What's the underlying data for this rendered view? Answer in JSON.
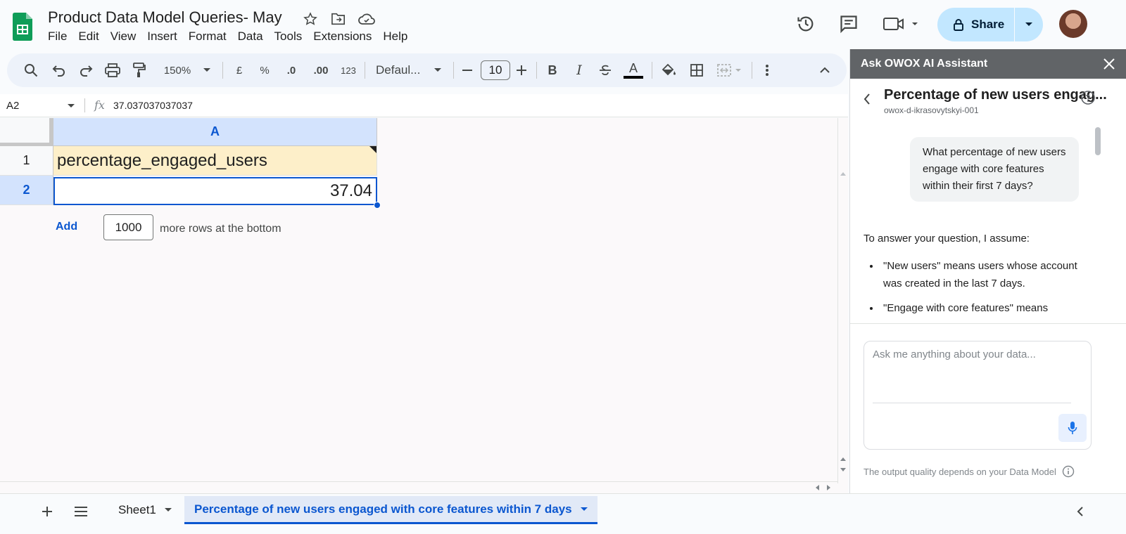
{
  "header": {
    "title": "Product Data Model Queries- May",
    "menu": [
      "File",
      "Edit",
      "View",
      "Insert",
      "Format",
      "Data",
      "Tools",
      "Extensions",
      "Help"
    ],
    "share_label": "Share"
  },
  "toolbar": {
    "zoom": "150%",
    "currency": "£",
    "percent": "%",
    "dec_decrease": ".0",
    "dec_increase": ".00",
    "number_format": "123",
    "font": "Defaul...",
    "font_size": "10",
    "bold": "B",
    "italic": "I",
    "text_color": "A"
  },
  "formula_bar": {
    "cell_ref": "A2",
    "value": "37.037037037037"
  },
  "sheet": {
    "column_a": "A",
    "rows": [
      {
        "num": "1",
        "value": "percentage_engaged_users"
      },
      {
        "num": "2",
        "value": "37.04"
      }
    ],
    "add_label": "Add",
    "add_rows_count": "1000",
    "add_rows_suffix": "more rows at the bottom"
  },
  "tabs": {
    "sheet1": "Sheet1",
    "active": "Percentage of new users engaged with core features within 7 days"
  },
  "panel": {
    "title": "Ask OWOX AI Assistant",
    "conversation_title": "Percentage of new users engag...",
    "project": "owox-d-ikrasovytskyi-001",
    "question": "What percentage of new users engage with core features within their first 7 days?",
    "answer_intro": "To answer your question, I assume:",
    "assumptions": [
      "\"New users\" means users whose account was created in the last 7 days.",
      "\"Engage with core features\" means"
    ],
    "input_placeholder": "Ask me anything about your data...",
    "footnote": "The output quality depends on your Data Model"
  },
  "colors": {
    "accent": "#0b57d0",
    "share_bg": "#c2e7ff",
    "header_row_fill": "#fdefc9",
    "panel_header": "#616467"
  }
}
